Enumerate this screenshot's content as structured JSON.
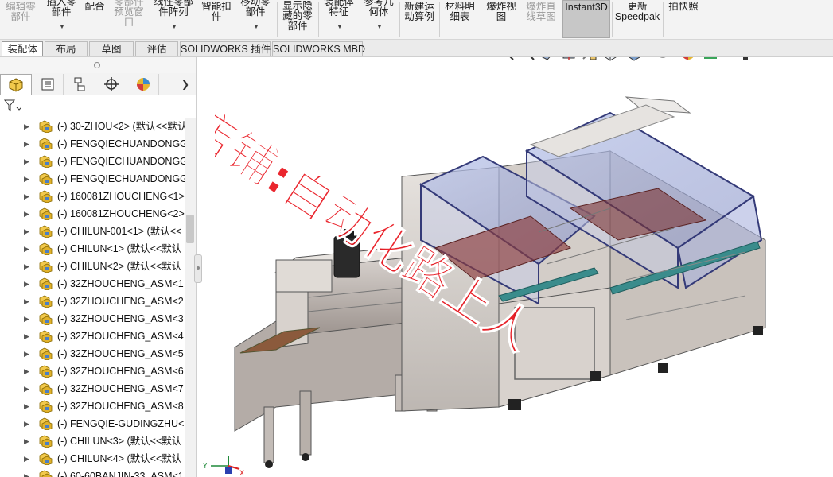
{
  "ribbon": {
    "items": [
      {
        "id": "edit-component",
        "label": "编辑零\n部件",
        "dim": true
      },
      {
        "id": "insert-component",
        "label": "插入零\n部件",
        "dim": false,
        "caret": true
      },
      {
        "id": "mate",
        "label": "配合",
        "dim": false
      },
      {
        "id": "component-preview",
        "label": "零部件\n预览窗\n口",
        "dim": true
      },
      {
        "id": "linear-pattern",
        "label": "线性零部\n件阵列",
        "dim": false,
        "caret": true
      },
      {
        "id": "smart-fasteners",
        "label": "智能扣\n件",
        "dim": false
      },
      {
        "id": "move-component",
        "label": "移动零\n部件",
        "dim": false,
        "caret": true
      },
      {
        "id": "show-hidden",
        "label": "显示隐\n藏的零\n部件",
        "dim": false
      },
      {
        "id": "assembly-features",
        "label": "装配体\n特征",
        "dim": false,
        "caret": true
      },
      {
        "id": "reference-geometry",
        "label": "参考几\n何体",
        "dim": false,
        "caret": true
      },
      {
        "id": "new-motion-study",
        "label": "新建运\n动算例",
        "dim": false
      },
      {
        "id": "bom",
        "label": "材料明\n细表",
        "dim": false
      },
      {
        "id": "exploded-view",
        "label": "爆炸视\n图",
        "dim": false
      },
      {
        "id": "explode-line",
        "label": "爆炸直\n线草图",
        "dim": true
      },
      {
        "id": "instant3d",
        "label": "Instant3D",
        "dim": false
      },
      {
        "id": "update-speedpak",
        "label": "更新\nSpeedpak",
        "dim": false
      },
      {
        "id": "snapshot",
        "label": "拍快照",
        "dim": false
      }
    ]
  },
  "tabs": [
    "装配体",
    "布局",
    "草图",
    "评估",
    "SOLIDWORKS 插件",
    "SOLIDWORKS MBD"
  ],
  "active_tab": "装配体",
  "panel_tabs": [
    "feature-manager-icon",
    "property-manager-icon",
    "configuration-manager-icon",
    "dimxpert-icon",
    "display-manager-icon"
  ],
  "tree": [
    "(-) 30-ZHOU<2> (默认<<默认",
    "(-) FENGQIECHUANDONGG",
    "(-) FENGQIECHUANDONGG",
    "(-) FENGQIECHUANDONGG",
    "(-) 160081ZHOUCHENG<1>",
    "(-) 160081ZHOUCHENG<2>",
    "(-) CHILUN-001<1> (默认<<",
    "(-) CHILUN<1> (默认<<默认",
    "(-) CHILUN<2> (默认<<默认",
    "(-) 32ZHOUCHENG_ASM<1",
    "(-) 32ZHOUCHENG_ASM<2",
    "(-) 32ZHOUCHENG_ASM<3",
    "(-) 32ZHOUCHENG_ASM<4",
    "(-) 32ZHOUCHENG_ASM<5",
    "(-) 32ZHOUCHENG_ASM<6",
    "(-) 32ZHOUCHENG_ASM<7",
    "(-) 32ZHOUCHENG_ASM<8",
    "(-) FENGQIE-GUDINGZHU<",
    "(-) CHILUN<3> (默认<<默认",
    "(-) CHILUN<4> (默认<<默认",
    "(-) 60-60BANJIN-33_ASM<1"
  ],
  "hud_icons": [
    "zoom-to-fit-icon",
    "zoom-to-area-icon",
    "previous-view-icon",
    "section-view-icon",
    "dynamic-annotation-icon",
    "view-orientation-icon",
    "display-style-icon",
    "hide-show-icon",
    "edit-appearance-icon",
    "apply-scene-icon",
    "view-settings-icon"
  ],
  "watermark": {
    "line1": "店铺:自动化路上人",
    "color": "#e8141c"
  },
  "triad": {
    "x": "X",
    "y": "Y",
    "z": "Z"
  }
}
